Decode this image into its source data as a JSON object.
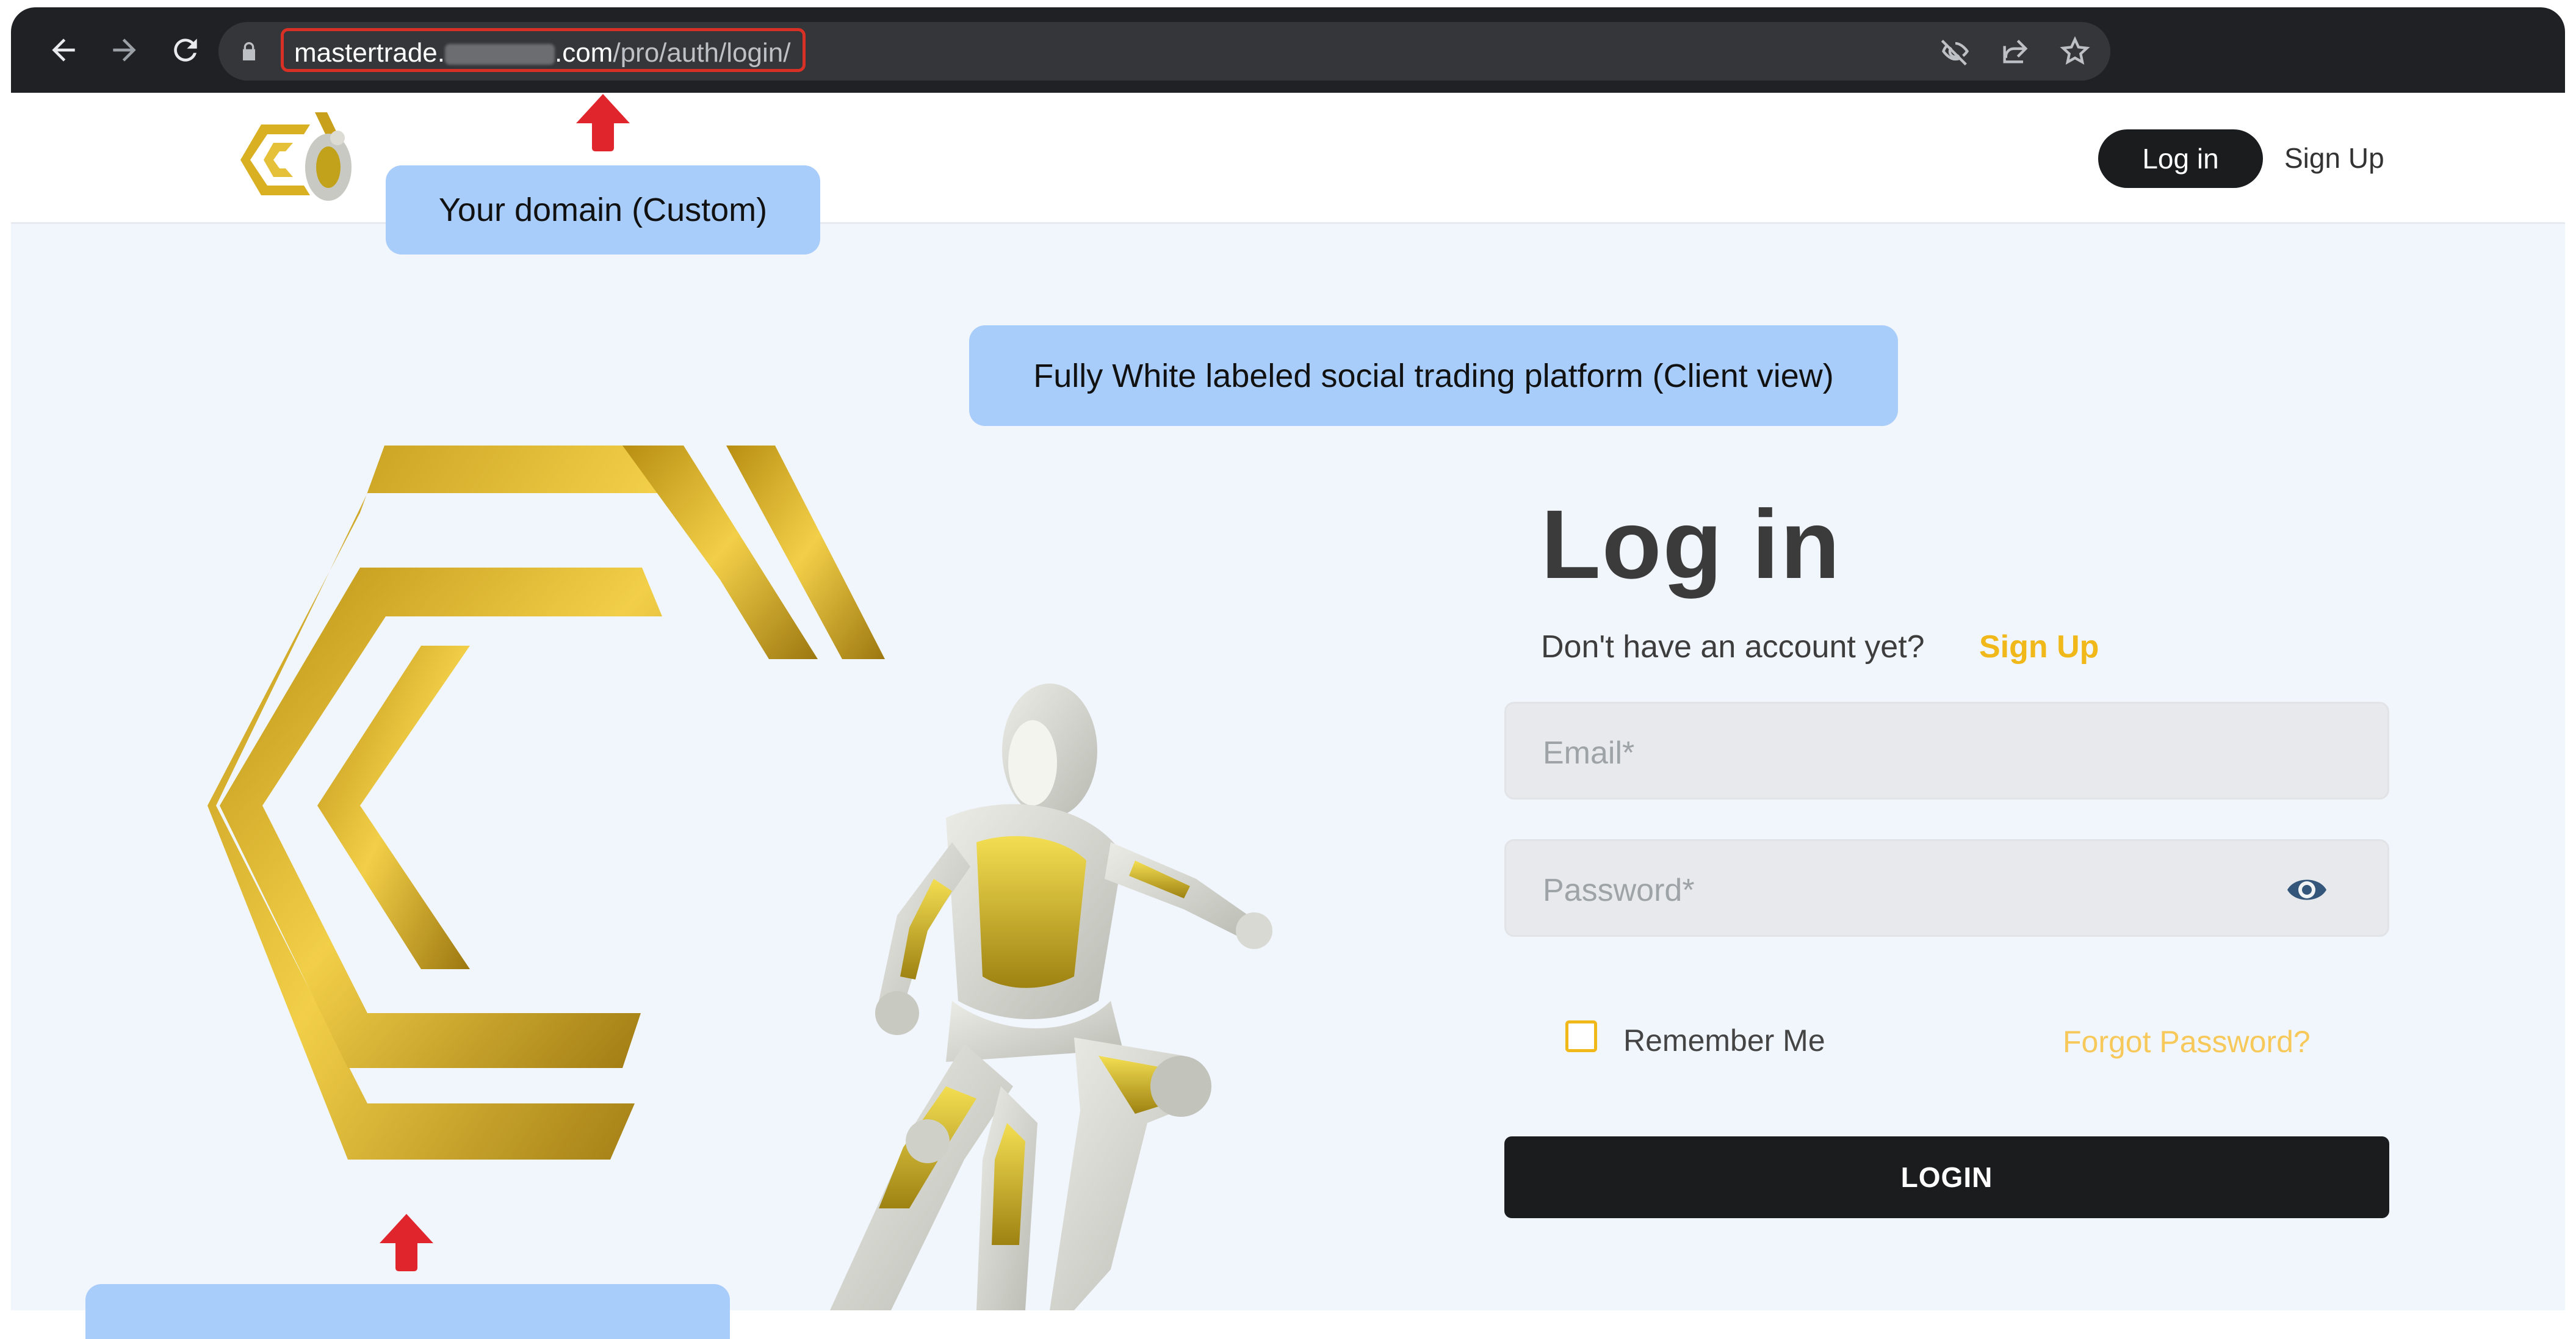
{
  "browser": {
    "url_host": "mastertrade.",
    "url_host_suffix": ".com",
    "url_path": "/pro/auth/login/"
  },
  "header": {
    "login_label": "Log in",
    "signup_label": "Sign Up"
  },
  "annotations": {
    "domain": "Your domain (Custom)",
    "platform": "Fully White labeled social trading platform (Client view)"
  },
  "form": {
    "title": "Log in",
    "no_account": "Don't have an account yet?",
    "signup_link": "Sign Up",
    "email_placeholder": "Email*",
    "password_placeholder": "Password*",
    "remember": "Remember Me",
    "forgot": "Forgot Password?",
    "submit": "LOGIN"
  },
  "colors": {
    "accent": "#f0b818",
    "dark_button": "#1b1c1e",
    "callout": "#a9cdfa",
    "background": "#f1f5fc"
  },
  "icons": [
    "back-arrow-icon",
    "forward-arrow-icon",
    "reload-icon",
    "lock-icon",
    "eye-slash-icon",
    "share-icon",
    "star-icon",
    "eye-icon"
  ]
}
